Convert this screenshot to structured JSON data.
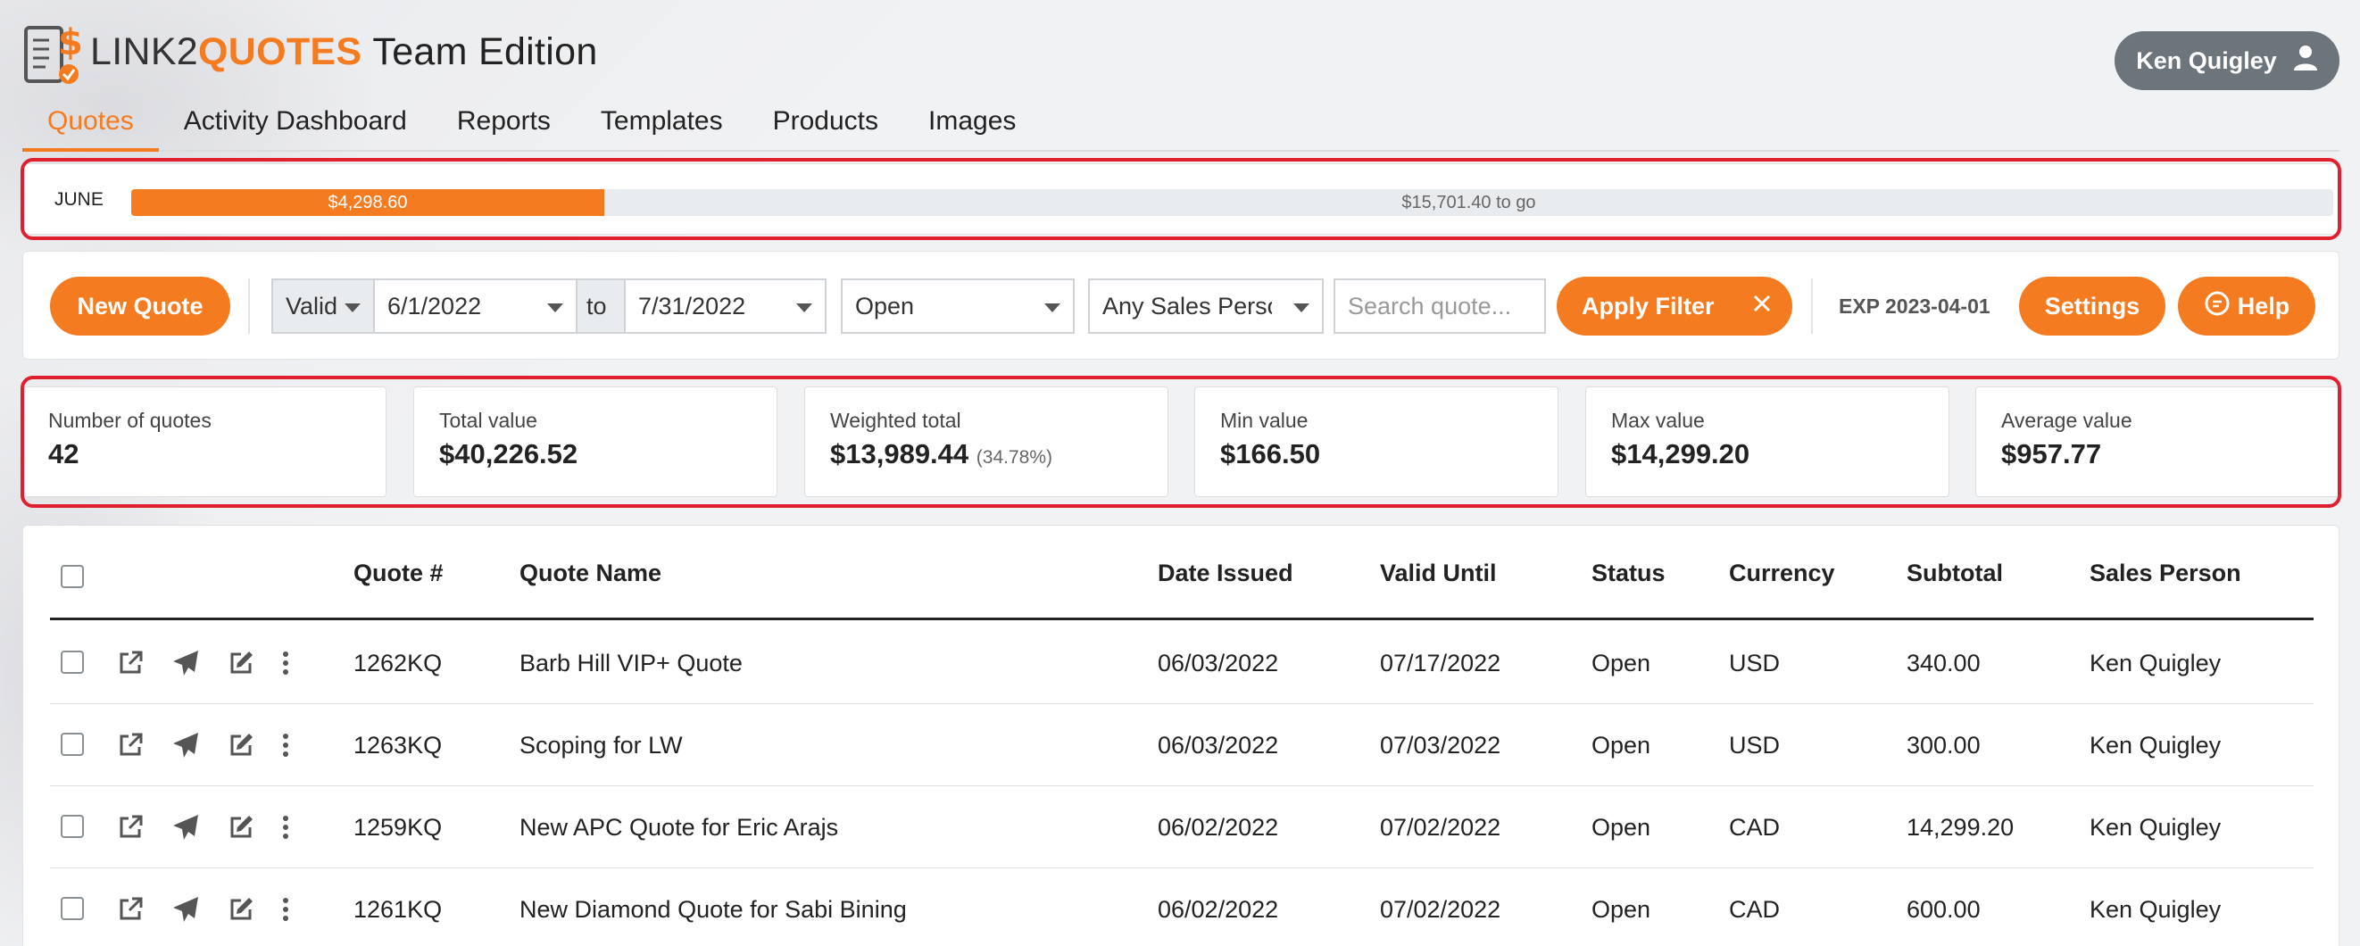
{
  "brand": {
    "part1": "LINK2",
    "part2": "QUOTES",
    "part3": "Team Edition"
  },
  "user": {
    "name": "Ken Quigley",
    "icon": "person-icon"
  },
  "tabs": [
    {
      "label": "Quotes",
      "active": true
    },
    {
      "label": "Activity Dashboard"
    },
    {
      "label": "Reports"
    },
    {
      "label": "Templates"
    },
    {
      "label": "Products"
    },
    {
      "label": "Images"
    }
  ],
  "progress": {
    "month": "JUNE",
    "achieved": "$4,298.60",
    "remaining": "$15,701.40 to go",
    "fraction": 0.2149
  },
  "filters": {
    "new_quote": "New Quote",
    "date_field": "Valid",
    "date_from": "6/1/2022",
    "to_label": "to",
    "date_to": "7/31/2022",
    "status": "Open",
    "sales_person": "Any Sales Person",
    "search_placeholder": "Search quote...",
    "apply": "Apply Filter",
    "clear_icon": "close-icon",
    "exp": "EXP 2023-04-01",
    "settings": "Settings",
    "help": "Help"
  },
  "stats": [
    {
      "label": "Number of quotes",
      "value": "42"
    },
    {
      "label": "Total value",
      "value": "$40,226.52"
    },
    {
      "label": "Weighted total",
      "value": "$13,989.44",
      "pct": "(34.78%)"
    },
    {
      "label": "Min value",
      "value": "$166.50"
    },
    {
      "label": "Max value",
      "value": "$14,299.20"
    },
    {
      "label": "Average value",
      "value": "$957.77"
    }
  ],
  "table": {
    "columns": [
      "Quote #",
      "Quote Name",
      "Date Issued",
      "Valid Until",
      "Status",
      "Currency",
      "Subtotal",
      "Sales Person"
    ],
    "rows": [
      {
        "num": "1262KQ",
        "name": "Barb Hill VIP+ Quote",
        "issued": "06/03/2022",
        "valid": "07/17/2022",
        "status": "Open",
        "currency": "USD",
        "subtotal": "340.00",
        "person": "Ken Quigley"
      },
      {
        "num": "1263KQ",
        "name": "Scoping for LW",
        "issued": "06/03/2022",
        "valid": "07/03/2022",
        "status": "Open",
        "currency": "USD",
        "subtotal": "300.00",
        "person": "Ken Quigley"
      },
      {
        "num": "1259KQ",
        "name": "New APC Quote for Eric Arajs",
        "issued": "06/02/2022",
        "valid": "07/02/2022",
        "status": "Open",
        "currency": "CAD",
        "subtotal": "14,299.20",
        "person": "Ken Quigley"
      },
      {
        "num": "1261KQ",
        "name": "New Diamond Quote for Sabi Bining",
        "issued": "06/02/2022",
        "valid": "07/02/2022",
        "status": "Open",
        "currency": "CAD",
        "subtotal": "600.00",
        "person": "Ken Quigley"
      }
    ]
  },
  "colors": {
    "accent": "#f47b20",
    "highlight": "#e0202e",
    "user_button": "#6c747c"
  }
}
